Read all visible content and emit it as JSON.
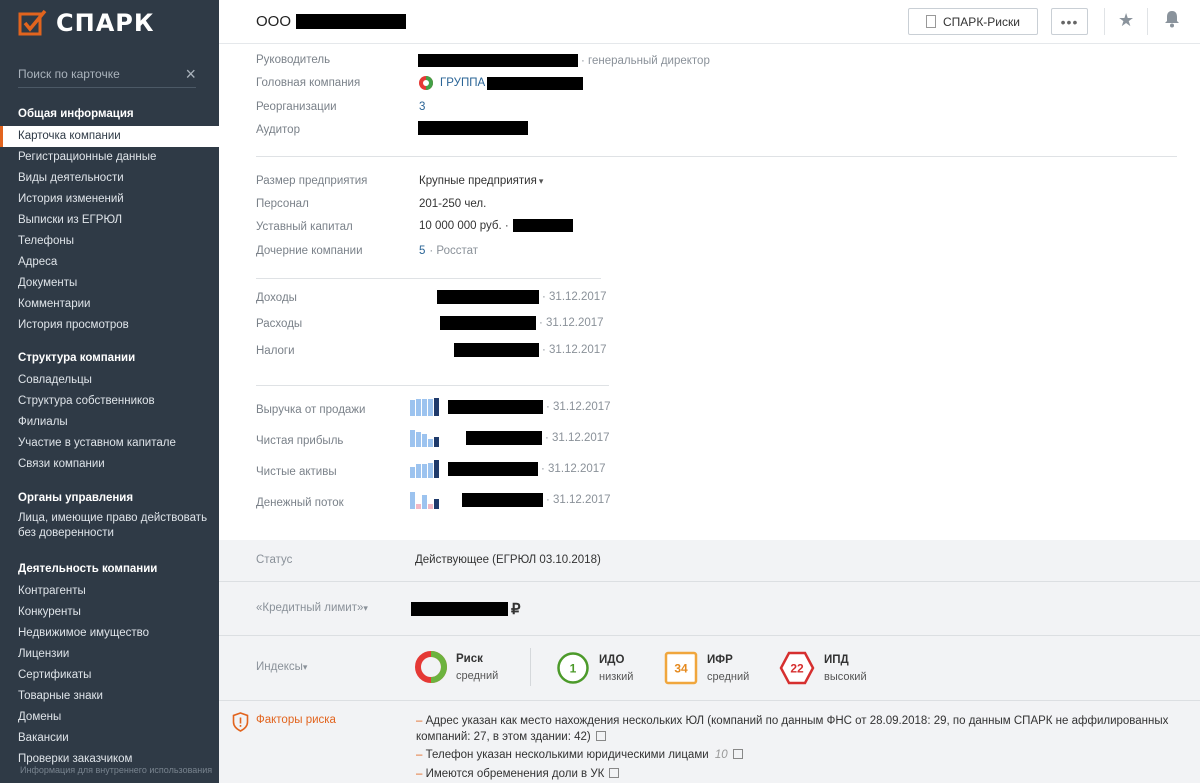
{
  "colors": {
    "accent": "#e2641e",
    "sidebar": "#2f3a46",
    "link": "#2a6496"
  },
  "sidebar": {
    "logo": "СПАРК",
    "search_placeholder": "Поиск по карточке",
    "sections": [
      {
        "title": "Общая информация",
        "items": [
          "Карточка компании",
          "Регистрационные данные",
          "Виды деятельности",
          "История изменений",
          "Выписки из ЕГРЮЛ",
          "Телефоны",
          "Адреса",
          "Документы",
          "Комментарии",
          "История просмотров"
        ]
      },
      {
        "title": "Структура компании",
        "items": [
          "Совладельцы",
          "Структура собственников",
          "Филиалы",
          "Участие в уставном капитале",
          "Связи компании"
        ]
      },
      {
        "title": "Органы управления",
        "items": [
          "Лица, имеющие право действовать без доверенности"
        ]
      },
      {
        "title": "Деятельность компании",
        "items": [
          "Контрагенты",
          "Конкуренты",
          "Недвижимое имущество",
          "Лицензии",
          "Сертификаты",
          "Товарные знаки",
          "Домены",
          "Вакансии",
          "Проверки заказчиком"
        ]
      }
    ],
    "footer": "Информация для внутреннего использования"
  },
  "header": {
    "company_prefix": "ООО",
    "risk_button": "СПАРК-Риски",
    "more_button": "•••"
  },
  "card": {
    "leader_label": "Руководитель",
    "leader_role": "· генеральный директор",
    "parent_label": "Головная компания",
    "parent_value": "ГРУППА",
    "reorg_label": "Реорганизации",
    "reorg_value": "3",
    "auditor_label": "Аудитор",
    "size_label": "Размер предприятия",
    "size_value": "Крупные предприятия",
    "staff_label": "Персонал",
    "staff_value": "201-250 чел.",
    "capital_label": "Уставный капитал",
    "capital_value": "10 000 000 руб. ·",
    "subs_label": "Дочерние компании",
    "subs_count": "5",
    "subs_source": "· Росстат",
    "income_label": "Доходы",
    "income_date": "· 31.12.2017",
    "expense_label": "Расходы",
    "expense_date": "· 31.12.2017",
    "tax_label": "Налоги",
    "tax_date": "· 31.12.2017",
    "revenue_label": "Выручка от продажи",
    "revenue_date": "· 31.12.2017",
    "profit_label": "Чистая прибыль",
    "profit_date": "· 31.12.2017",
    "assets_label": "Чистые активы",
    "assets_date": "· 31.12.2017",
    "cashflow_label": "Денежный поток",
    "cashflow_date": "· 31.12.2017"
  },
  "sparklines": {
    "revenue": [
      0.9,
      0.95,
      0.95,
      0.95,
      1.0
    ],
    "profit": [
      0.95,
      0.85,
      0.7,
      0.45,
      0.55
    ],
    "assets": [
      0.6,
      0.75,
      0.8,
      0.85,
      1.0
    ],
    "cashflow": [
      0.95,
      0.3,
      0.8,
      0.25,
      0.55
    ]
  },
  "panel": {
    "status_label": "Статус",
    "status_value": "Действующее (ЕГРЮЛ 03.10.2018)",
    "credit_label": "«Кредитный лимит»",
    "credit_currency": "₽",
    "indices_label": "Индексы",
    "indices": [
      {
        "name": "Риск",
        "level": "средний",
        "value": ""
      },
      {
        "name": "ИДО",
        "level": "низкий",
        "value": "1"
      },
      {
        "name": "ИФР",
        "level": "средний",
        "value": "34"
      },
      {
        "name": "ИПД",
        "level": "высокий",
        "value": "22"
      }
    ],
    "risk_factors_label": "Факторы риска",
    "risk_factors": [
      "Адрес указан как место нахождения нескольких ЮЛ (компаний по данным ФНС от 28.09.2018: 29, по данным СПАРК не аффилированных компаний: 27, в этом здании: 42)",
      "Телефон указан несколькими юридическими лицами",
      "Имеются обременения доли в УК"
    ],
    "phone_count": "10"
  }
}
